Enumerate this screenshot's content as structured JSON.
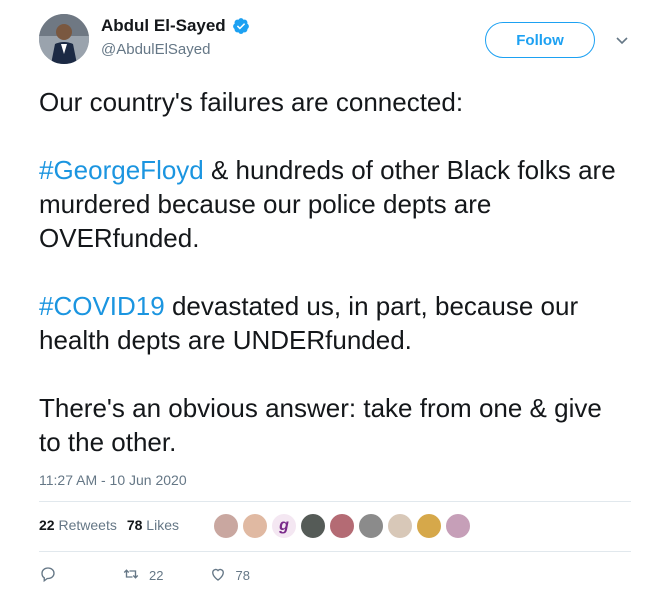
{
  "author": {
    "display_name": "Abdul El-Sayed",
    "handle": "@AbdulElSayed",
    "verified": true
  },
  "follow_label": "Follow",
  "tweet": {
    "paragraphs": [
      {
        "parts": [
          {
            "text": "Our country's failures are connected:"
          }
        ]
      },
      {
        "parts": [
          {
            "text": "#GeorgeFloyd",
            "hashtag": true
          },
          {
            "text": " & hundreds of other Black folks are murdered because our police depts are OVERfunded."
          }
        ]
      },
      {
        "parts": [
          {
            "text": "#COVID19",
            "hashtag": true
          },
          {
            "text": " devastated us, in part, because our health depts are UNDERfunded."
          }
        ]
      },
      {
        "parts": [
          {
            "text": "There's an obvious answer: take from one & give to the other."
          }
        ]
      }
    ]
  },
  "timestamp": "11:27 AM - 10 Jun 2020",
  "stats": {
    "retweets_count": "22",
    "retweets_label": "Retweets",
    "likes_count": "78",
    "likes_label": "Likes"
  },
  "liker_avatars": [
    {
      "color": "#c9a7a0"
    },
    {
      "color": "#e0b9a2"
    },
    {
      "color": "#f4e7f2",
      "glyph": "g"
    },
    {
      "color": "#555b57"
    },
    {
      "color": "#b46b74"
    },
    {
      "color": "#8b8b8b"
    },
    {
      "color": "#d8c8b8"
    },
    {
      "color": "#d6a84a"
    },
    {
      "color": "#c69fb8"
    }
  ],
  "actions": {
    "reply_icon": "reply-icon",
    "retweet_count": "22",
    "like_count": "78"
  },
  "colors": {
    "accent": "#1da1f2",
    "hashtag": "#1b95e0",
    "muted": "#657786",
    "text": "#14171a"
  }
}
